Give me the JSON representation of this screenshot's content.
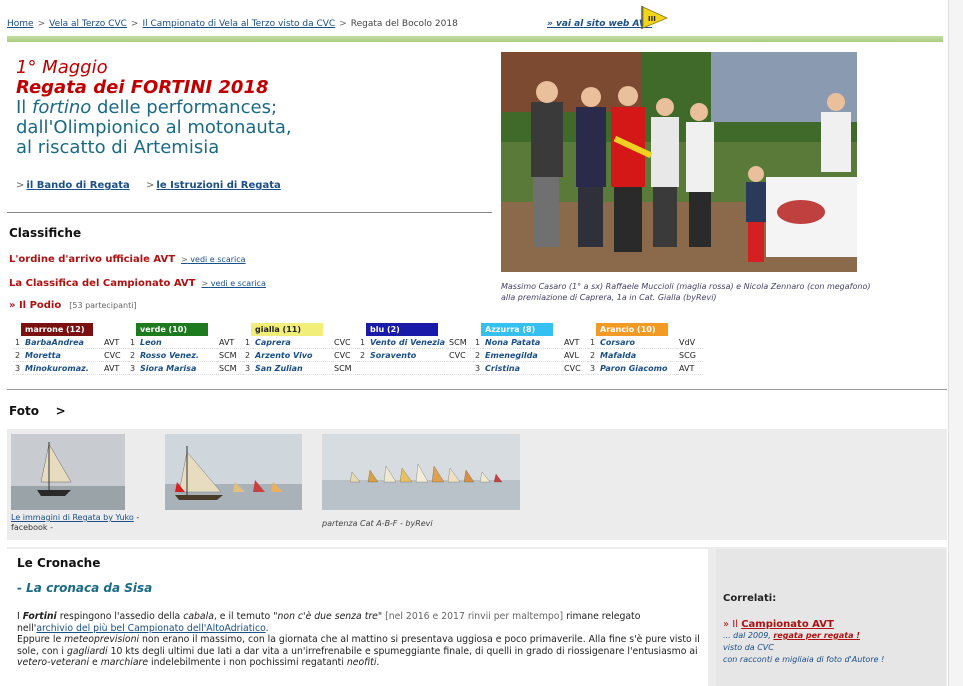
{
  "breadcrumb": {
    "items": [
      "Home",
      "Vela al Terzo CVC",
      "Il Campionato di Vela al Terzo visto da CVC"
    ],
    "current": "Regata del Bocolo 2018",
    "sep": ">"
  },
  "header_link": {
    "prefix": "» vai al",
    "label": "sito web AVT"
  },
  "heading": {
    "date": "1° Maggio",
    "title": "Regata dei FORTINI 2018",
    "line1_pre": "Il ",
    "line1_em": "fortino",
    "line1_post": " delle performances;",
    "line2": "dall'Olimpionico al motonauta,",
    "line3": "al riscatto di Artemisia"
  },
  "docs": {
    "bando_pre": "il ",
    "bando": "Bando di Regata",
    "istruzioni_pre": "le ",
    "istruzioni": "Istruzioni di Regata"
  },
  "photo": {
    "caption1": "Massimo Casaro (1° a sx) Raffaele Muccioli (maglia rossa) e Nicola Zennaro (con megafono)",
    "caption2": "alla premiazione di Caprera, 1a in Cat. Gialla (byRevi)"
  },
  "classifiche": {
    "title": "Classifiche",
    "row1": "L'ordine d'arrivo ufficiale AVT",
    "row2": "La Classifica del Campionato AVT",
    "download": "vedi e scarica",
    "podio": "» Il Podio",
    "participants": "[53 partecipanti]"
  },
  "podium": [
    {
      "name": "marrone (12)",
      "color": "#7a1010",
      "rows": [
        [
          "1",
          "BarbaAndrea",
          "AVT"
        ],
        [
          "2",
          "Moretta",
          "CVC"
        ],
        [
          "3",
          "Minokuromaz.",
          "AVT"
        ]
      ]
    },
    {
      "name": "verde (10)",
      "color": "#1e7a1e",
      "rows": [
        [
          "1",
          "Leon",
          "AVT"
        ],
        [
          "2",
          "Rosso Venez.",
          "SCM"
        ],
        [
          "3",
          "Siora Marisa",
          "SCM"
        ]
      ]
    },
    {
      "name": "gialla (11)",
      "color": "#f2ee7a",
      "text": "#222",
      "rows": [
        [
          "1",
          "Caprera",
          "CVC"
        ],
        [
          "2",
          "Arzento Vivo",
          "CVC"
        ],
        [
          "3",
          "San Zulian",
          "SCM"
        ]
      ]
    },
    {
      "name": "blu (2)",
      "color": "#1a1aa8",
      "rows": [
        [
          "1",
          "Vento di Venezia",
          "SCM"
        ],
        [
          "2",
          "Soravento",
          "CVC"
        ]
      ]
    },
    {
      "name": "Azzurra (8)",
      "color": "#34c0f0",
      "rows": [
        [
          "1",
          "Nona Patata",
          "AVT"
        ],
        [
          "2",
          "Emenegilda",
          "AVL"
        ],
        [
          "3",
          "Cristina",
          "CVC"
        ]
      ]
    },
    {
      "name": "Arancio (10)",
      "color": "#f39a25",
      "rows": [
        [
          "1",
          "Corsaro",
          "VdV"
        ],
        [
          "2",
          "Mafalda",
          "SCG"
        ],
        [
          "3",
          "Paron Giacomo",
          "AVT"
        ]
      ]
    }
  ],
  "foto": {
    "title": "Foto",
    "arrow": ">",
    "cap1_link": "Le immagini di Regata by Yuko",
    "cap1_rest": " - facebook -",
    "cap3": "partenza Cat A-B-F - byRevi"
  },
  "cronache": {
    "title": "Le Cronache",
    "sub": "- La cronaca da Sisa",
    "p1_a": "I ",
    "p1_b": "Fortini",
    "p1_c": " respingono l'assedio della ",
    "p1_d": "cabala",
    "p1_e": ", e il temuto \"",
    "p1_f": "non c'è due senza tre",
    "p1_g": "\" ",
    "p1_h": "[nel 2016 e 2017 rinvii per maltempo]",
    "p1_i": " rimane relegato",
    "p2_a": "nell'",
    "p2_b": "archivio del più bel Campionato dell'AltoAdriatico",
    "p2_c": ".",
    "p3_a": "Eppure le ",
    "p3_b": "meteoprevisioni",
    "p3_c": " non erano il massimo, con la giornata che al mattino si presentava uggiosa e poco primaverile. Alla fine s'è pure visto il sole, con i ",
    "p3_d": "gagliardi",
    "p3_e": " 10 kts degli ultimi due lati a dar vita a un'irrefrenabile e spumeggiante finale, di quelli in grado di riossigenare l'entusiasmo ai ",
    "p3_f": "vetero-veterani",
    "p3_g": " e ",
    "p3_h": "marchiare",
    "p3_i": " indelebilmente i non pochissimi regatanti ",
    "p3_j": "neofiti",
    "p3_k": "."
  },
  "correlati": {
    "title": "Correlati:",
    "l1_pre": "» Il ",
    "l1": "Campionato AVT",
    "l2_pre": "... dal 2009, ",
    "l2": "regata per regata !",
    "l3": "visto da CVC",
    "l4": "con racconti e migliaia di foto d'Autore !"
  }
}
